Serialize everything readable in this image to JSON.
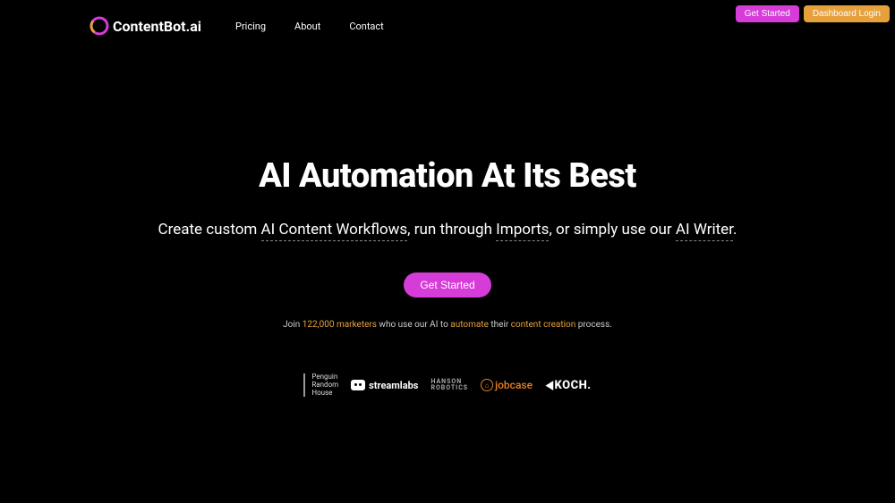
{
  "topButtons": {
    "getStarted": "Get Started",
    "dashboardLogin": "Dashboard Login"
  },
  "logo": {
    "text": "ContentBot.ai"
  },
  "nav": {
    "pricing": "Pricing",
    "about": "About",
    "contact": "Contact"
  },
  "hero": {
    "title": "AI Automation At Its Best",
    "sub": {
      "t1": "Create custom ",
      "u1": "AI Content Workflows",
      "t2": ", run through ",
      "u2": "Imports",
      "t3": ", or simply use our ",
      "u3": "AI Writer",
      "t4": "."
    },
    "cta": "Get Started"
  },
  "joinLine": {
    "t1": "Join ",
    "h1": "122,000 marketers",
    "t2": " who use our AI to ",
    "h2": "automate",
    "t3": " their ",
    "h3": "content creation",
    "t4": " process."
  },
  "brands": {
    "prh": {
      "l1": "Penguin",
      "l2": "Random",
      "l3": "House"
    },
    "streamlabs": "streamlabs",
    "hanson": {
      "l1": "HANSON",
      "l2": "ROBOTICS"
    },
    "jobcase": "jobcase",
    "koch": "KOCH"
  }
}
